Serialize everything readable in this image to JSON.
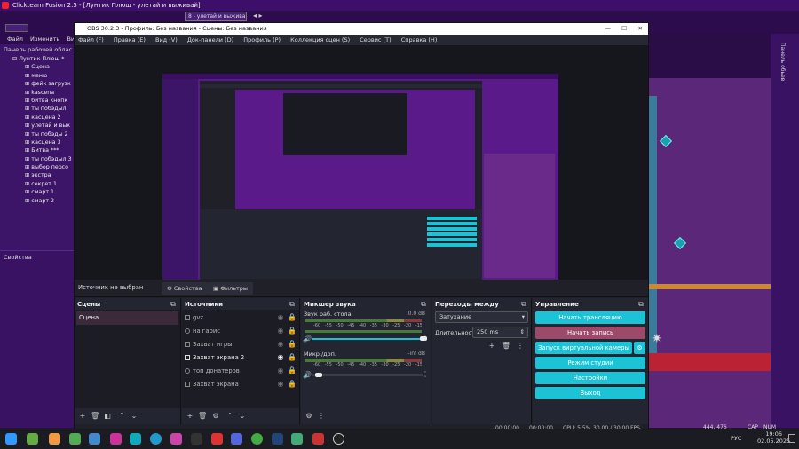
{
  "fusion": {
    "title": "Clickteam Fusion 2.5 - [Лунтик Плюш - улетай и выживай]",
    "frame_select": "8 - улетай и выживай",
    "menu": [
      "Файл",
      "Изменить",
      "Вид"
    ],
    "workspace_label": "Панель рабочей облас",
    "tree_root": "Лунтик Плюш *",
    "tree_items": [
      "Сцена",
      "меню",
      "фейк загрузк",
      "kascena",
      "битва кнопк",
      "ты побэдыл",
      "касцена 2",
      "улетай и вык",
      "ты побэды 2",
      "касцена 3",
      "Битва ***",
      "ты побэдыл 3",
      "выбор персо",
      "экстра",
      "секрет 1",
      "смарт 1",
      "смарт 2"
    ],
    "properties_label": "Свойства",
    "right_panel_label": "Панель обьев",
    "coords": "444, 476",
    "cap": "CAP",
    "num": "NUM"
  },
  "obs": {
    "title": "OBS 30.2.3 - Профиль: Без названия - Сцены: Без названия",
    "menu": [
      "Файл (F)",
      "Правка (E)",
      "Вид (V)",
      "Док-панели (D)",
      "Профиль (P)",
      "Коллекция сцен (S)",
      "Сервис (T)",
      "Справка (H)"
    ],
    "no_source": "Источник не выбран",
    "properties_btn": "Свойства",
    "filters_btn": "Фильтры",
    "scenes": {
      "title": "Сцены",
      "items": [
        "Сцена"
      ]
    },
    "sources": {
      "title": "Источники",
      "items": [
        "gvz",
        "на гарис",
        "Захват игры",
        "Захват экрана 2",
        "топ донатеров",
        "Захват экрана"
      ]
    },
    "mixer": {
      "title": "Микшер звука",
      "channels": [
        {
          "name": "Звук раб. стола",
          "db": "0.0 dB"
        },
        {
          "name": "Микр./доп.",
          "db": "-inf dB"
        }
      ],
      "ticks": "-60 -55 -50 -45 -40 -35 -30 -25 -20 -15 -10 -5 0"
    },
    "transitions": {
      "title": "Переходы между сценами",
      "selected": "Затухание",
      "duration_label": "Длительность",
      "duration": "250 ms"
    },
    "controls": {
      "title": "Управление",
      "buttons": [
        "Начать трансляцию",
        "Начать запись",
        "Запуск виртуальной камеры",
        "Режим студии",
        "Настройки",
        "Выход"
      ]
    },
    "status": {
      "t1": "00:00:00",
      "t2": "00:00:00",
      "cpu": "CPU: 5.5%",
      "fps": "30.00 / 30.00 FPS"
    }
  },
  "taskbar": {
    "lang": "РУС",
    "time": "19:06",
    "date": "02.05.2025"
  },
  "colors": {
    "accent": "#1cc3d6",
    "recording": "#9b4a6a",
    "fusion_bg": "#2a0d47"
  }
}
